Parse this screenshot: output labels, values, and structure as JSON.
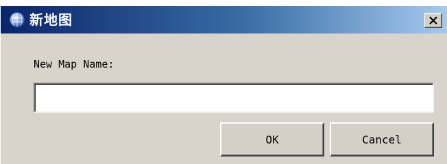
{
  "window": {
    "title": "新地图",
    "icon": "globe-icon",
    "close_icon": "close-icon"
  },
  "form": {
    "label": "New Map Name:",
    "input_value": "",
    "input_placeholder": ""
  },
  "buttons": {
    "ok_label": "OK",
    "cancel_label": "Cancel"
  },
  "colors": {
    "titlebar_start": "#0a246a",
    "titlebar_end": "#a6caf0",
    "dialog_face": "#d8d4cc"
  }
}
